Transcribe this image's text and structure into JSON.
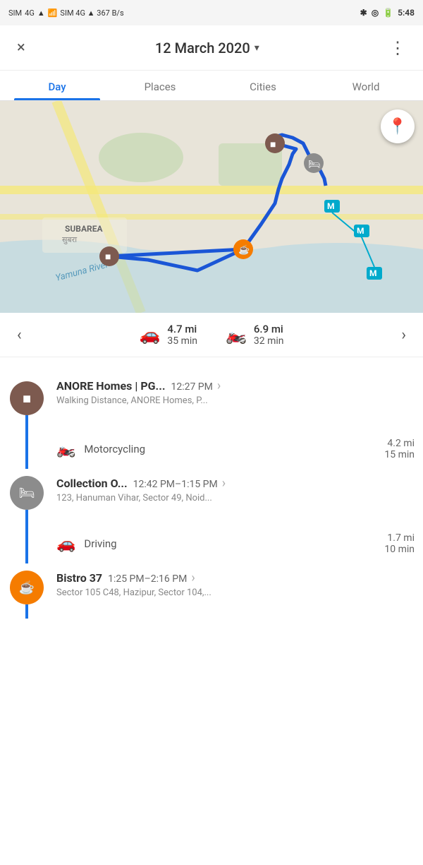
{
  "statusBar": {
    "left": "SIM 4G ▲ 367 B/s",
    "bluetooth": "⚡",
    "battery": "100",
    "time": "5:48"
  },
  "header": {
    "closeLabel": "×",
    "title": "12 March 2020",
    "dropdownArrow": "▾",
    "moreLabel": "⋮"
  },
  "tabs": [
    {
      "id": "day",
      "label": "Day",
      "active": true
    },
    {
      "id": "places",
      "label": "Places",
      "active": false
    },
    {
      "id": "cities",
      "label": "Cities",
      "active": false
    },
    {
      "id": "world",
      "label": "World",
      "active": false
    }
  ],
  "transport": {
    "prevArrow": "‹",
    "nextArrow": "›",
    "carIcon": "🚗",
    "carDistance": "4.7 mi",
    "carTime": "35 min",
    "motoIcon": "🏍",
    "motoDistance": "6.9 mi",
    "motoTime": "32 min"
  },
  "timeline": [
    {
      "id": "entry-1",
      "iconType": "brown",
      "iconChar": "■",
      "name": "ANORE Homes | PG...",
      "time": "12:27 PM",
      "address": "Walking Distance, ANORE Homes, P...",
      "hasChevron": true
    },
    {
      "id": "segment-1",
      "segmentType": "travel",
      "icon": "🏍",
      "label": "Motorcycling",
      "distance": "4.2 mi",
      "duration": "15 min"
    },
    {
      "id": "entry-2",
      "iconType": "gray",
      "iconChar": "🛏",
      "name": "Collection O...",
      "time": "12:42 PM–1:15 PM",
      "address": "123, Hanuman Vihar, Sector 49, Noid...",
      "hasChevron": true
    },
    {
      "id": "segment-2",
      "segmentType": "travel",
      "icon": "🚗",
      "label": "Driving",
      "distance": "1.7 mi",
      "duration": "10 min"
    },
    {
      "id": "entry-3",
      "iconType": "orange",
      "iconChar": "☕",
      "name": "Bistro 37",
      "time": "1:25 PM–2:16 PM",
      "address": "Sector 105 C48, Hazipur, Sector 104,...",
      "hasChevron": true
    }
  ]
}
